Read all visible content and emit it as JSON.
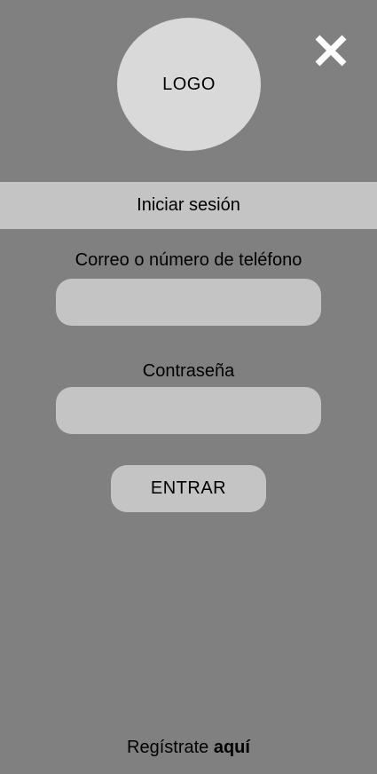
{
  "logo": {
    "text": "LOGO"
  },
  "close": {
    "icon": "close-icon"
  },
  "header": {
    "title": "Iniciar sesión"
  },
  "form": {
    "email_label": "Correo o número de teléfono",
    "email_value": "",
    "password_label": "Contraseña",
    "password_value": "",
    "submit_label": "ENTRAR"
  },
  "footer": {
    "register_text": "Regístrate",
    "register_link": "aquí"
  },
  "colors": {
    "background": "#808080",
    "logo_circle": "#d9d9d9",
    "controls": "#c4c4c4",
    "close_icon": "#ffffff",
    "text": "#000000"
  }
}
